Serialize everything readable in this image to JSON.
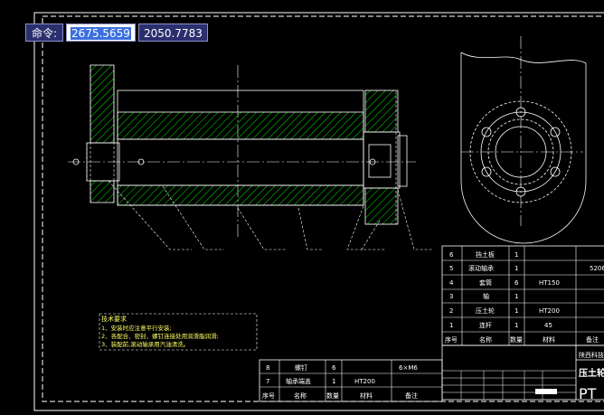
{
  "command_bar": {
    "label": "命令:",
    "x_value": "2675.5659",
    "y_value": "2050.7783"
  },
  "parts_table_right": {
    "rows": [
      {
        "no": "6",
        "name": "挡土板",
        "qty": "1",
        "material": "",
        "extra": ""
      },
      {
        "no": "5",
        "name": "滚动轴承",
        "qty": "1",
        "material": "",
        "extra": "5206"
      },
      {
        "no": "4",
        "name": "套筒",
        "qty": "6",
        "material": "HT150",
        "extra": ""
      },
      {
        "no": "3",
        "name": "轴",
        "qty": "1",
        "material": "",
        "extra": ""
      },
      {
        "no": "2",
        "name": "压土轮",
        "qty": "1",
        "material": "HT200",
        "extra": ""
      },
      {
        "no": "1",
        "name": "连杆",
        "qty": "1",
        "material": "45",
        "extra": ""
      }
    ],
    "header": {
      "no": "序号",
      "name": "名称",
      "qty": "数量",
      "material": "材料",
      "remark": "备注"
    }
  },
  "parts_table_left": {
    "rows": [
      {
        "no": "8",
        "name": "螺钉",
        "qty": "6",
        "material": "",
        "remark": "6×M6"
      },
      {
        "no": "7",
        "name": "轴承端盖",
        "qty": "1",
        "material": "HT200",
        "remark": ""
      }
    ],
    "header": {
      "no": "序号",
      "name": "名称",
      "qty": "数量",
      "material": "材料",
      "remark": "备注"
    }
  },
  "title_block": {
    "school": "陕西科技",
    "title": "压土轮",
    "code": "PT"
  },
  "notes": {
    "title": "技术要求",
    "lines": [
      "1、安装时应注意平行安装;",
      "2、各配合、密封、螺钉连接处用润滑脂润滑;",
      "3、装配前,滚动轴承用汽油清洗。"
    ]
  },
  "colors": {
    "background": "#000000",
    "line": "#ffffff",
    "hatch": "#00c800",
    "annotation": "#ffff66",
    "command_bg": "#2b2f6e"
  }
}
